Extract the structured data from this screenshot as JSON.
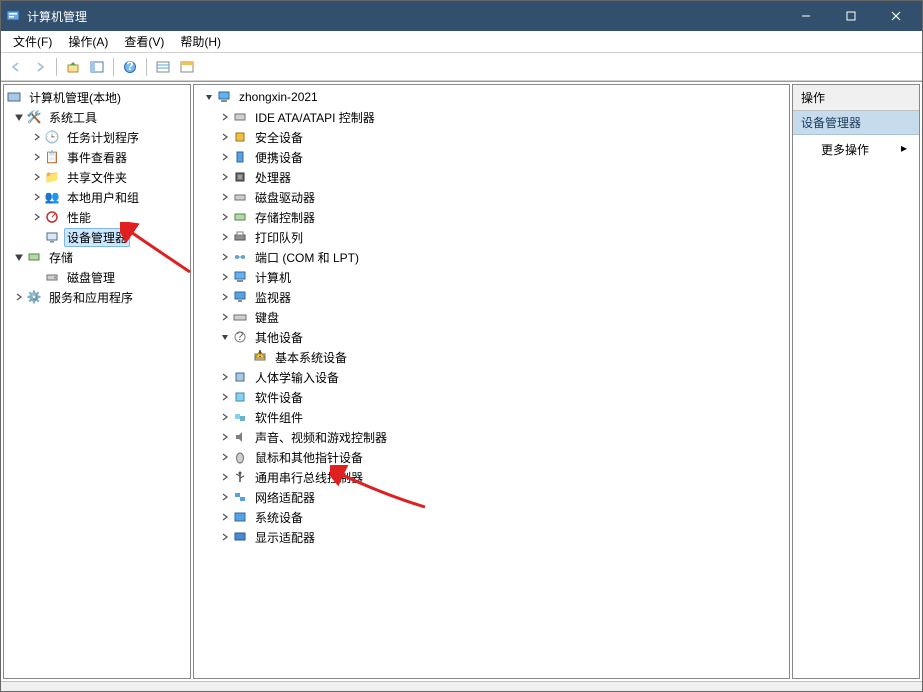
{
  "window": {
    "title": "计算机管理"
  },
  "menu": {
    "file": "文件(F)",
    "action": "操作(A)",
    "view": "查看(V)",
    "help": "帮助(H)"
  },
  "left_tree": {
    "root": "计算机管理(本地)",
    "system_tools": "系统工具",
    "task_scheduler": "任务计划程序",
    "event_viewer": "事件查看器",
    "shared_folders": "共享文件夹",
    "local_users": "本地用户和组",
    "performance": "性能",
    "device_manager": "设备管理器",
    "storage": "存储",
    "disk_management": "磁盘管理",
    "services": "服务和应用程序"
  },
  "center_tree": {
    "root": "zhongxin-2021",
    "ide": "IDE ATA/ATAPI 控制器",
    "security": "安全设备",
    "portable": "便携设备",
    "processor": "处理器",
    "disk_drive": "磁盘驱动器",
    "storage_ctrl": "存储控制器",
    "print_queue": "打印队列",
    "ports": "端口 (COM 和 LPT)",
    "computer": "计算机",
    "monitor": "监视器",
    "keyboard": "键盘",
    "other_devices": "其他设备",
    "base_system": "基本系统设备",
    "hid": "人体学输入设备",
    "software_devices": "软件设备",
    "software_components": "软件组件",
    "audio": "声音、视频和游戏控制器",
    "mouse": "鼠标和其他指针设备",
    "usb": "通用串行总线控制器",
    "network": "网络适配器",
    "system_devices": "系统设备",
    "display": "显示适配器"
  },
  "right": {
    "header": "操作",
    "section": "设备管理器",
    "more_actions": "更多操作"
  }
}
